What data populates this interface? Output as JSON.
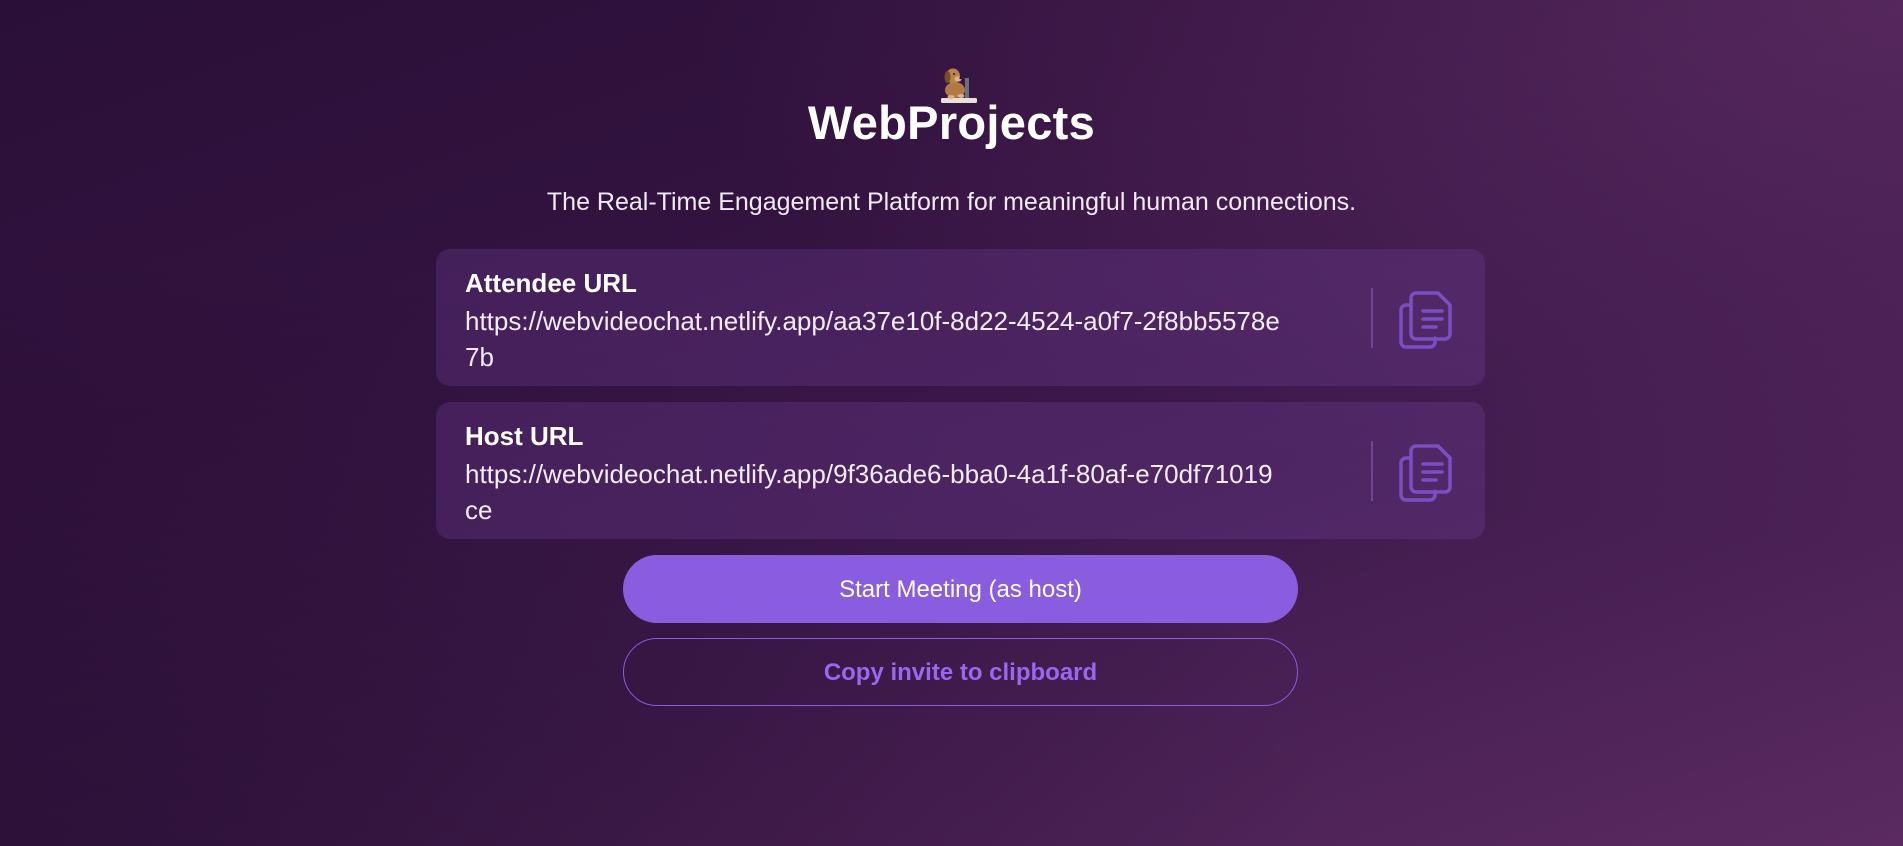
{
  "brand": {
    "name": "WebProjects",
    "logo_icon": "cartoon-dog-at-laptop-icon"
  },
  "tagline": "The Real-Time Engagement Platform for meaningful human connections.",
  "attendee": {
    "label": "Attendee URL",
    "url": "https://webvideochat.netlify.app/aa37e10f-8d22-4524-a0f7-2f8bb5578e7b",
    "copy_icon": "copy-icon"
  },
  "host": {
    "label": "Host URL",
    "url": "https://webvideochat.netlify.app/9f36ade6-bba0-4a1f-80af-e70df71019ce",
    "copy_icon": "copy-icon"
  },
  "actions": {
    "start_meeting": "Start Meeting (as host)",
    "copy_invite": "Copy invite to clipboard"
  },
  "colors": {
    "accent": "#8a5ce0",
    "accent_text": "#9b66f0",
    "card_bg": "rgba(120,70,160,0.28)",
    "copy_icon": "#7b4fc4"
  }
}
